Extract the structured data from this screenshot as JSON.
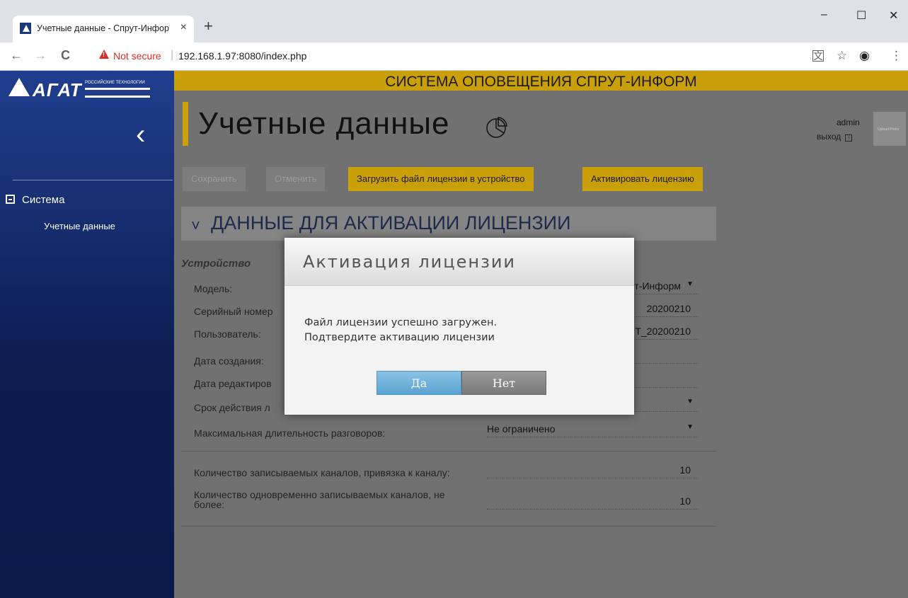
{
  "browser": {
    "tab_title": "Учетные данные - Спрут-Инфор",
    "tab_close": "×",
    "new_tab": "+",
    "minimize": "–",
    "maximize": "☐",
    "close": "✕",
    "back": "←",
    "forward": "→",
    "reload": "C",
    "security_warning": "Not secure",
    "separator": "|",
    "url": "192.168.1.97:8080/index.php",
    "translate_icon": "translate-icon",
    "bookmark": "☆",
    "profile": "◉",
    "menu": "⋮"
  },
  "sidebar": {
    "logo_text": "АГАТ",
    "logo_sub": "РОССИЙСКИЕ ТЕХНОЛОГИИ",
    "collapse": "‹",
    "group_label": "Система",
    "item_label": "Учетные данные"
  },
  "header": {
    "banner": "СИСТЕМА ОПОВЕЩЕНИЯ СПРУТ-ИНФОРМ",
    "page_title": "Учетные данные",
    "user_name": "admin",
    "logout_label": "выход",
    "avatar_text": "Upload Photo"
  },
  "toolbar": {
    "save": "Сохранить",
    "cancel": "Отменить",
    "upload_license": "Загрузить файл лицензии в устройство",
    "activate_license": "Активировать лицензию"
  },
  "section": {
    "chevron": "˅",
    "title": "ДАННЫЕ ДЛЯ АКТИВАЦИИ ЛИЦЕНЗИИ",
    "subtitle": "Устройство"
  },
  "fields": {
    "model_label": "Модель:",
    "model_value": "т-Информ",
    "serial_label": "Серийный номер",
    "serial_value": "20200210",
    "user_label": "Пользователь:",
    "user_value": "Т_20200210",
    "created_label": "Дата создания:",
    "edited_label": "Дата редактиров",
    "validity_label": "Срок действия л",
    "max_duration_label": "Максимальная длительность разговоров:",
    "max_duration_value": "Не ограничено",
    "rec_channels_label": "Количество записываемых каналов, привязка к каналу:",
    "rec_channels_value": "10",
    "simul_channels_label_1": "Количество одновременно записываемых каналов, не",
    "simul_channels_label_2": "более:",
    "simul_channels_value": "10",
    "dropdown": "▼"
  },
  "modal": {
    "title": "Активация лицензии",
    "message_line1": "Файл лицензии успешно загружен.",
    "message_line2": "Подтвердите активацию лицензии",
    "yes": "Да",
    "no": "Нет"
  },
  "colors": {
    "accent": "#caa00a",
    "sidebar": "#0c1d52",
    "warning": "#d93025"
  }
}
